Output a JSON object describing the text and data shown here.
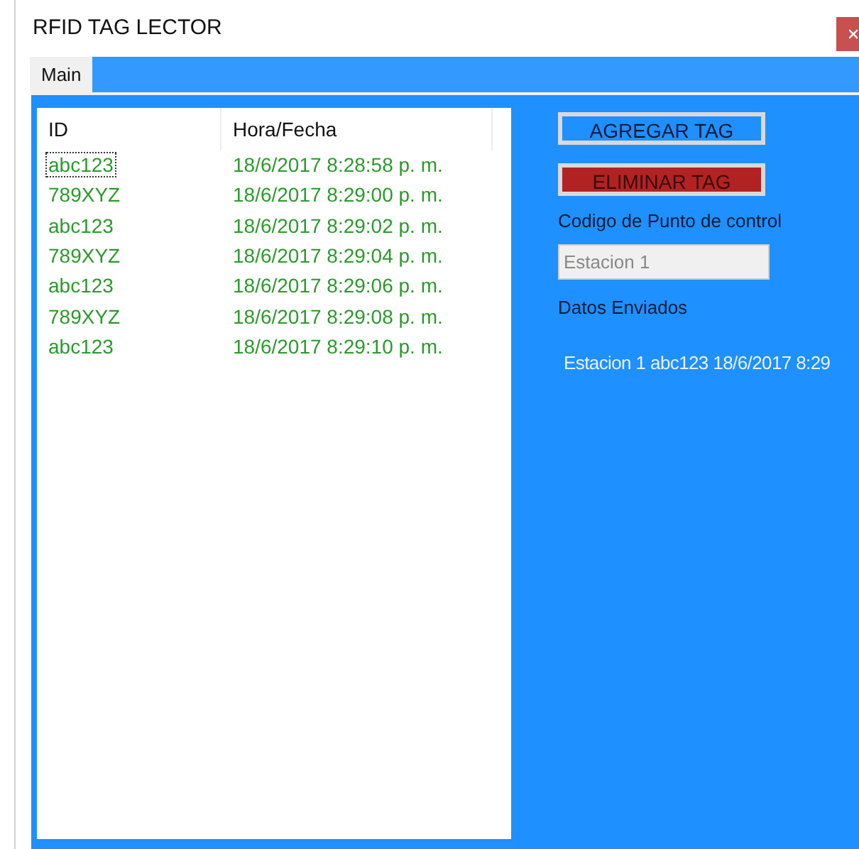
{
  "window": {
    "title": "RFID TAG LECTOR"
  },
  "tabs": [
    {
      "label": "Main",
      "selected": true
    }
  ],
  "table": {
    "columns": [
      "ID",
      "Hora/Fecha"
    ],
    "rows": [
      {
        "id": "abc123",
        "time": "18/6/2017 8:28:58 p. m.",
        "selected": true
      },
      {
        "id": "789XYZ",
        "time": "18/6/2017 8:29:00 p. m.",
        "selected": false
      },
      {
        "id": "abc123",
        "time": "18/6/2017 8:29:02 p. m.",
        "selected": false
      },
      {
        "id": "789XYZ",
        "time": "18/6/2017 8:29:04 p. m.",
        "selected": false
      },
      {
        "id": "abc123",
        "time": "18/6/2017 8:29:06 p. m.",
        "selected": false
      },
      {
        "id": "789XYZ",
        "time": "18/6/2017 8:29:08 p. m.",
        "selected": false
      },
      {
        "id": "abc123",
        "time": "18/6/2017 8:29:10 p. m.",
        "selected": false
      }
    ]
  },
  "buttons": [
    {
      "label": "AGREGAR TAG",
      "kind": "add"
    },
    {
      "label": "ELIMINAR TAG",
      "kind": "remove"
    }
  ],
  "checkpoint": {
    "label": "Codigo de Punto de control",
    "value": "Estacion 1",
    "disabled": true
  },
  "sent": {
    "label": "Datos Enviados",
    "value": "Estacion 1 abc123 18/6/2017 8:29"
  }
}
